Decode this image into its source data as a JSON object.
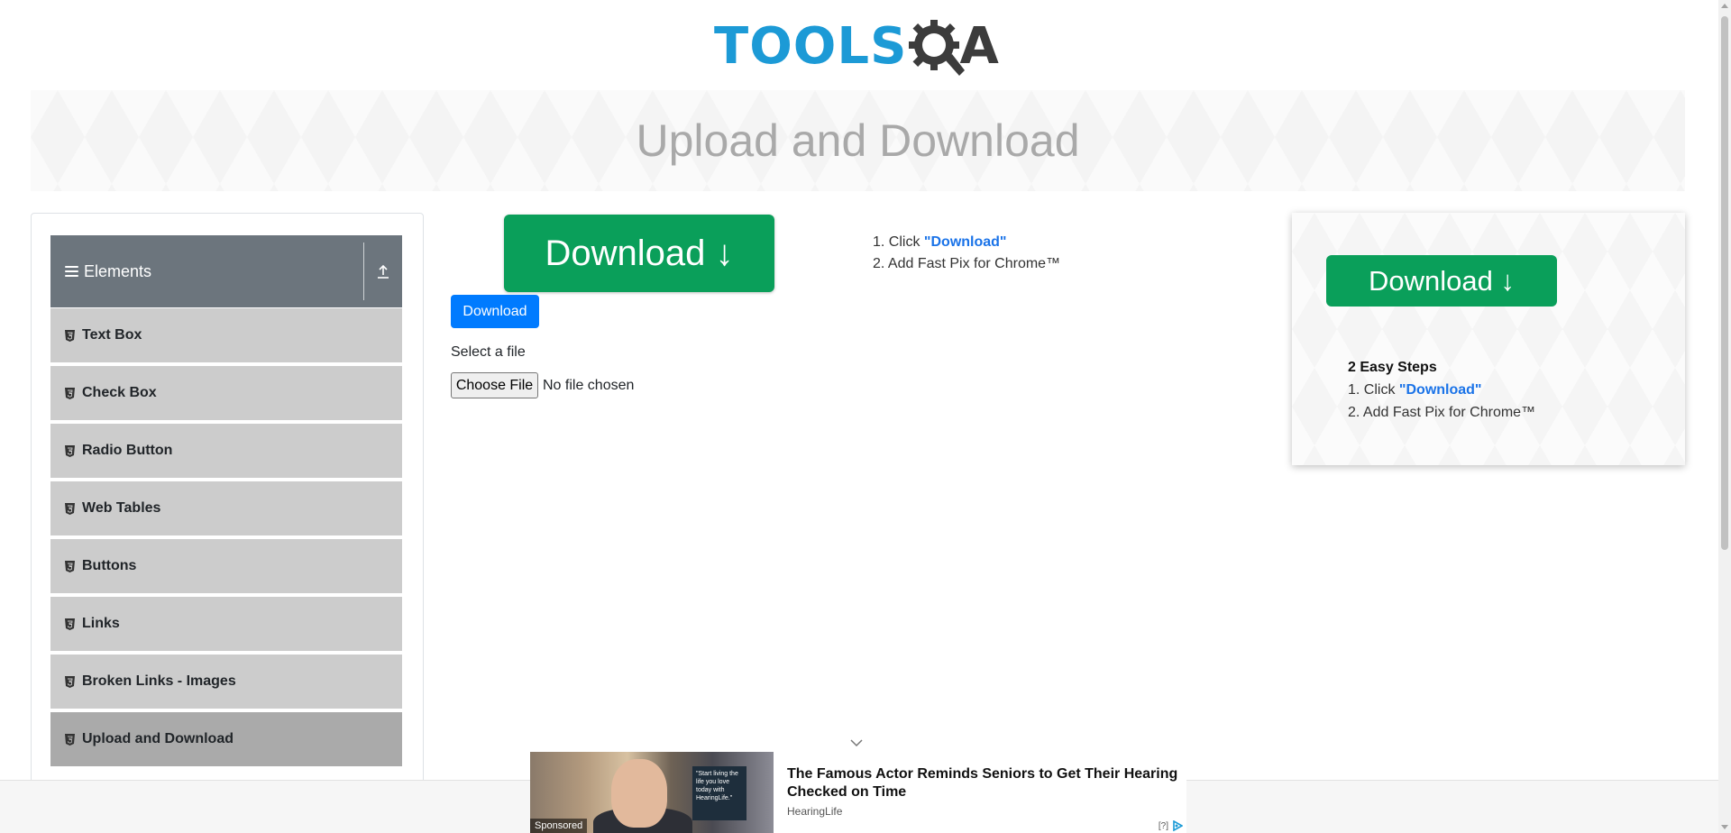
{
  "header": {
    "logo_text": "TOOLS",
    "logo_letter": "A",
    "logo_icon": "gear-magnifier-icon"
  },
  "banner": {
    "title": "Upload and Download"
  },
  "sidebar": {
    "group_title": "Elements",
    "group_icon": "hamburger-icon",
    "collapse_icon": "collapse-up-icon",
    "items": [
      {
        "label": "Text Box",
        "icon": "html5-icon",
        "active": false
      },
      {
        "label": "Check Box",
        "icon": "html5-icon",
        "active": false
      },
      {
        "label": "Radio Button",
        "icon": "html5-icon",
        "active": false
      },
      {
        "label": "Web Tables",
        "icon": "html5-icon",
        "active": false
      },
      {
        "label": "Buttons",
        "icon": "html5-icon",
        "active": false
      },
      {
        "label": "Links",
        "icon": "html5-icon",
        "active": false
      },
      {
        "label": "Broken Links - Images",
        "icon": "html5-icon",
        "active": false
      },
      {
        "label": "Upload and Download",
        "icon": "html5-icon",
        "active": true
      }
    ]
  },
  "main": {
    "promo_button_label": "Download ↓",
    "promo_steps": {
      "step1_prefix": "1. Click ",
      "step1_link": "\"Download\"",
      "step2": "2. Add Fast Pix for Chrome™"
    },
    "download_button_label": "Download",
    "select_file_label": "Select a file",
    "choose_file_label": "Choose File",
    "file_status": "No file chosen"
  },
  "ad_card": {
    "button_label": "Download ↓",
    "heading": "2 Easy Steps",
    "step1_prefix": "1. Click ",
    "step1_link": "\"Download\"",
    "step2": "2. Add Fast Pix for Chrome™"
  },
  "bottom_ad": {
    "sponsored_label": "Sponsored",
    "headline": "The Famous Actor Reminds Seniors to Get Their Hearing Checked on Time",
    "source": "HearingLife",
    "choice_label": "[?]",
    "photo_note": "\"Start living the life you love today with HearingLife.\"",
    "collapse_icon": "chevron-down-icon"
  },
  "colors": {
    "logo_blue": "#1c9ad6",
    "logo_dark": "#3c3c3c",
    "green": "#0a9f5a",
    "primary": "#007bff",
    "sidebar_header": "#6c757d",
    "sidebar_item": "#cccccc",
    "sidebar_item_active": "#aaaaaa",
    "link_blue": "#1a73e8"
  }
}
